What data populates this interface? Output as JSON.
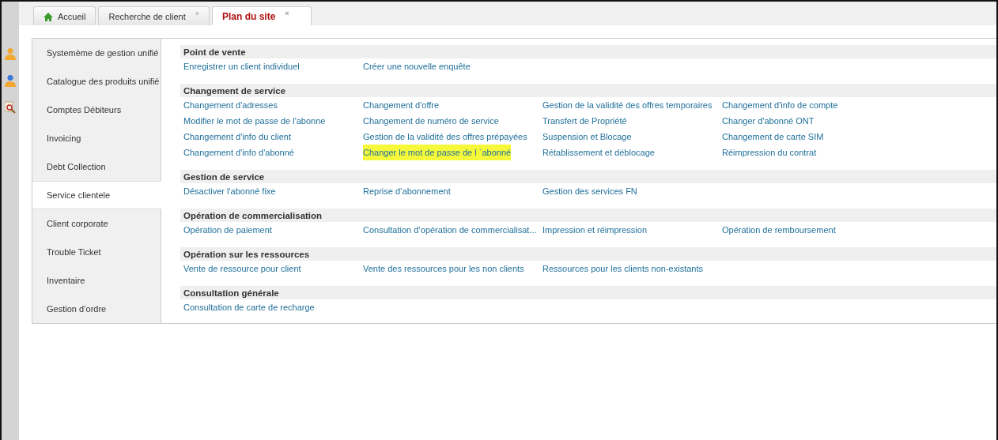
{
  "tabs": [
    {
      "label": "Accueil",
      "kind": "home",
      "selected": false
    },
    {
      "label": "Recherche de client",
      "kind": "closable",
      "close": "×",
      "selected": false
    },
    {
      "label": "Plan du site",
      "kind": "closable",
      "close": "×",
      "selected": true
    }
  ],
  "sidebar": {
    "items": [
      {
        "label": "Systemème de gestion unifié",
        "selected": false
      },
      {
        "label": "Catalogue des produits unifié",
        "selected": false
      },
      {
        "label": "Comptes Débiteurs",
        "selected": false
      },
      {
        "label": "Invoicing",
        "selected": false
      },
      {
        "label": "Debt Collection",
        "selected": false
      },
      {
        "label": "Service clientele",
        "selected": true
      },
      {
        "label": "Client corporate",
        "selected": false
      },
      {
        "label": "Trouble Ticket",
        "selected": false
      },
      {
        "label": "Inventaire",
        "selected": false
      },
      {
        "label": "Gestion d’ordre",
        "selected": false
      }
    ]
  },
  "sections": [
    {
      "title": "Point de vente",
      "links": [
        {
          "label": "Enregistrer un client individuel",
          "highlighted": false
        },
        {
          "label": "Créer une nouvelle enquête",
          "highlighted": false
        }
      ]
    },
    {
      "title": "Changement de service",
      "links": [
        {
          "label": "Changement d'adresses",
          "highlighted": false
        },
        {
          "label": "Changement d'offre",
          "highlighted": false
        },
        {
          "label": "Gestion de la validité des offres temporaires",
          "highlighted": false
        },
        {
          "label": "Changement d'info de compte",
          "highlighted": false
        },
        {
          "label": "Modifier le mot de passe de l'abonne",
          "highlighted": false
        },
        {
          "label": "Changement de numéro de service",
          "highlighted": false
        },
        {
          "label": "Transfert de Propriété",
          "highlighted": false
        },
        {
          "label": "Changer d'abonné ONT",
          "highlighted": false
        },
        {
          "label": "Changement d'info du client",
          "highlighted": false
        },
        {
          "label": "Gestion de la validité des offres prépayées",
          "highlighted": false
        },
        {
          "label": "Suspension et Blocage",
          "highlighted": false
        },
        {
          "label": "Changement de carte SIM",
          "highlighted": false
        },
        {
          "label": "Changement d'info d'abonné",
          "highlighted": false
        },
        {
          "label": "Changer le mot de passe de l `abonné",
          "highlighted": true
        },
        {
          "label": "Rétablissement et déblocage",
          "highlighted": false
        },
        {
          "label": "Réimpression du contrat",
          "highlighted": false
        }
      ]
    },
    {
      "title": "Gestion de service",
      "links": [
        {
          "label": "Désactiver l'abonné fixe",
          "highlighted": false
        },
        {
          "label": "Reprise d’abonnement",
          "highlighted": false
        },
        {
          "label": "Gestion des services FN",
          "highlighted": false
        }
      ]
    },
    {
      "title": "Opération de commercialisation",
      "links": [
        {
          "label": "Opération de paiement",
          "highlighted": false
        },
        {
          "label": "Consultation d’opération de commercialisat...",
          "highlighted": false
        },
        {
          "label": "Impression et réimpression",
          "highlighted": false
        },
        {
          "label": "Opération de remboursement",
          "highlighted": false
        }
      ]
    },
    {
      "title": "Opération sur les ressources",
      "links": [
        {
          "label": "Vente de ressource pour client",
          "highlighted": false
        },
        {
          "label": "Vente des ressources pour les non clients",
          "highlighted": false
        },
        {
          "label": "Ressources pour les clients non-existants",
          "highlighted": false
        }
      ]
    },
    {
      "title": "Consultation générale",
      "links": [
        {
          "label": "Consultation de carte de recharge",
          "highlighted": false
        }
      ]
    }
  ]
}
